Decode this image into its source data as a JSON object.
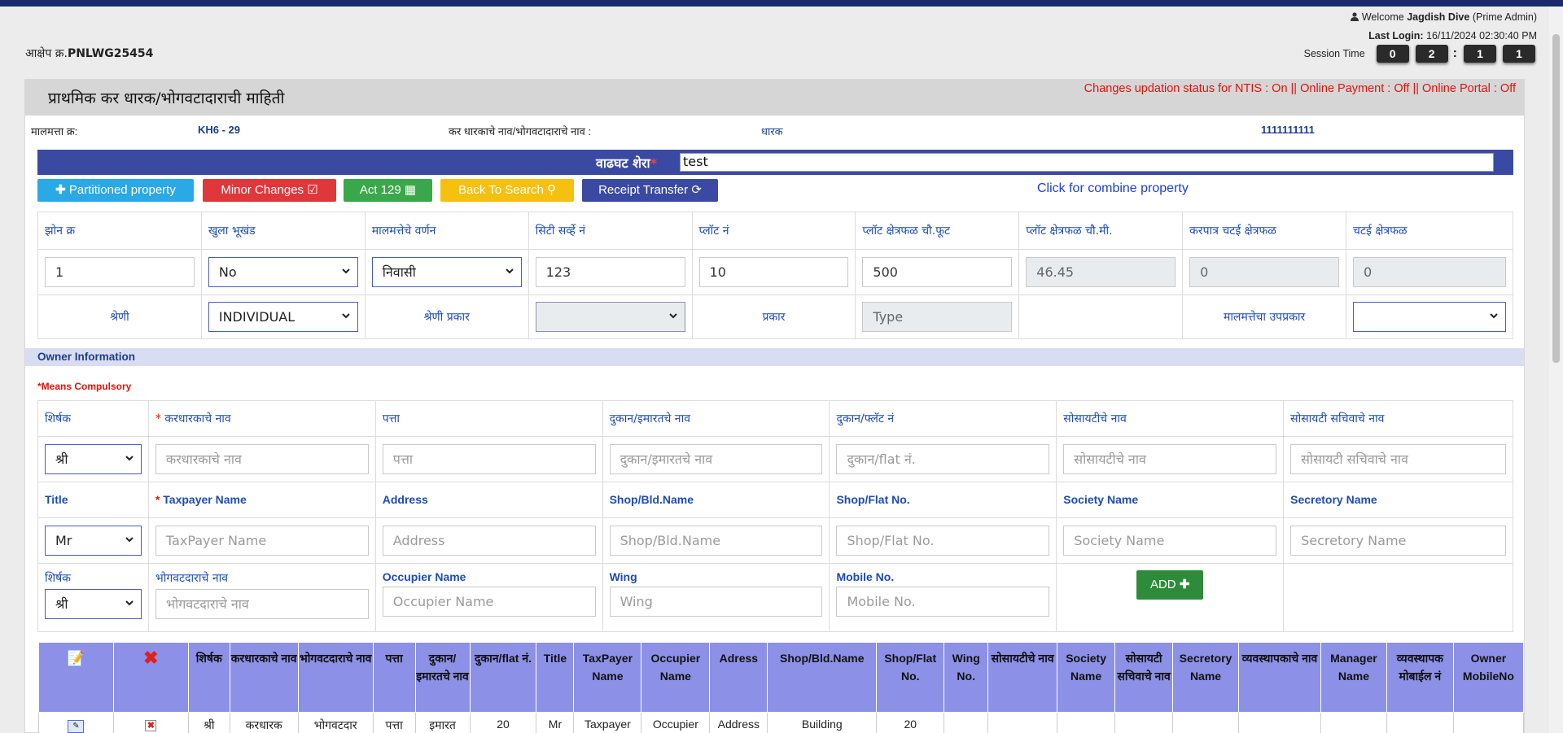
{
  "header": {
    "ref_label": "आक्षेप क्र.",
    "ref_value": "PNLWG25454",
    "welcome_prefix": "Welcome",
    "user_name": "Jagdish Dive",
    "user_role": "(Prime Admin)",
    "last_login_label": "Last Login:",
    "last_login_value": "16/11/2024 02:30:40 PM",
    "session_label": "Session Time",
    "session_digits": [
      "0",
      "2",
      "1",
      "1"
    ]
  },
  "panel": {
    "title": "प्राथमिक कर धारक/भोगवटादाराची माहिती",
    "status": "Changes updation status for NTIS : On || Online Payment : Off || Online Portal : Off",
    "property_no_label": "मालमत्ता क्र:",
    "property_no_value": "KH6 - 29",
    "holder_name_label": "कर धारकाचे नाव/भोगवटादाराचे नाव :",
    "holder_name_value": "धारक",
    "mobile_value": "1111111111",
    "remark_label": "वाढघट शेरा",
    "remark_value": "test"
  },
  "buttons": {
    "partitioned": "Partitioned property",
    "minor_changes": "Minor Changes",
    "act129": "Act 129",
    "back_search": "Back To Search",
    "receipt_transfer": "Receipt Transfer",
    "combine": "Click for combine property"
  },
  "property": {
    "headers": [
      "झोन क्र",
      "खुला भूखंड",
      "मालमत्तेचे वर्णन",
      "सिटी सर्व्हे नं",
      "प्लॉट नं",
      "प्लॉट क्षेत्रफळ चौ.फूट",
      "प्लॉट क्षेत्रफळ चौ.मी.",
      "करपात्र चटई क्षेत्रफळ",
      "चटई क्षेत्रफळ"
    ],
    "zone": "1",
    "open_plot": "No",
    "description": "निवासी",
    "city_survey": "123",
    "plot_no": "10",
    "area_sqft": "500",
    "area_sqm": "46.45",
    "taxable_carpet": "0",
    "carpet": "0",
    "category_label": "श्रेणी",
    "category_value": "INDIVIDUAL",
    "category_type_label": "श्रेणी प्रकार",
    "category_type_value": "",
    "type_label": "प्रकार",
    "type_placeholder": "Type",
    "subtype_label": "मालमत्तेचा उपप्रकार",
    "subtype_value": ""
  },
  "owner": {
    "section_title": "Owner Information",
    "compulsory_note": "*Means Compulsory",
    "mr_headers": [
      "शिर्षक",
      "करधारकाचे नाव",
      "पत्ता",
      "दुकान/इमारतचे नाव",
      "दुकान/फ्लॅट नं",
      "सोसायटीचे नाव",
      "सोसायटी सचिवाचे नाव"
    ],
    "mr_title_value": "श्री",
    "mr_placeholders": [
      "करधारकाचे नाव",
      "पत्ता",
      "दुकान/इमारतचे नाव",
      "दुकान/flat नं.",
      "सोसायटीचे नाव",
      "सोसायटी सचिवाचे नाव"
    ],
    "en_headers": [
      "Title",
      "Taxpayer Name",
      "Address",
      "Shop/Bld.Name",
      "Shop/Flat No.",
      "Society Name",
      "Secretory Name"
    ],
    "en_title_value": "Mr",
    "en_placeholders": [
      "TaxPayer Name",
      "Address",
      "Shop/Bld.Name",
      "Shop/Flat No.",
      "Society Name",
      "Secretory Name"
    ],
    "occ_headers": [
      "शिर्षक",
      "भोगवटदाराचे नाव",
      "Occupier Name",
      "Wing",
      "Mobile No."
    ],
    "occ_title_value": "श्री",
    "occ_placeholders": [
      "भोगवटदाराचे नाव",
      "Occupier Name",
      "Wing",
      "Mobile No."
    ],
    "add_label": "ADD"
  },
  "table": {
    "columns": [
      "",
      "",
      "शिर्षक",
      "करधारकाचे नाव",
      "भोगवटदाराचे नाव",
      "पत्ता",
      "दुकान/ इमारतचे नाव",
      "दुकान/flat नं.",
      "Title",
      "TaxPayer Name",
      "Occupier Name",
      "Adress",
      "Shop/Bld.Name",
      "Shop/Flat No.",
      "Wing No.",
      "सोसायटीचे नाव",
      "Society Name",
      "सोसायटी सचिवाचे नाव",
      "Secretory Name",
      "व्यवस्थापकाचे नाव",
      "Manager Name",
      "व्यवस्थापक मोबाईल नं",
      "Owner MobileNo"
    ],
    "rows": [
      [
        "",
        "",
        "श्री",
        "करधारक",
        "भोगवटदार",
        "पत्ता",
        "इमारत",
        "20",
        "Mr",
        "Taxpayer",
        "Occupier",
        "Address",
        "Building",
        "20",
        "",
        "",
        "",
        "",
        "",
        "",
        "",
        "",
        ""
      ]
    ]
  },
  "colors": {
    "accent": "#3a4aa3",
    "table_header": "#8c90e6",
    "status_red": "#e3120b"
  }
}
